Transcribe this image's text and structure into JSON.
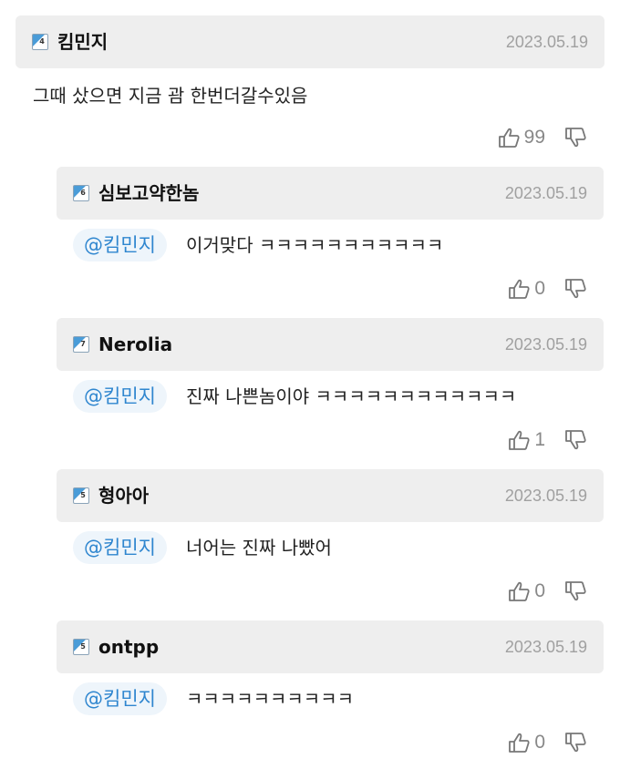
{
  "comments": [
    {
      "level": "4",
      "nickname": "킴민지",
      "date": "2023.05.19",
      "text": "그때 샀으면 지금 괌 한번더갈수있음",
      "likes": "99"
    }
  ],
  "replies": [
    {
      "level": "6",
      "nickname": "심보고약한놈",
      "date": "2023.05.19",
      "mention": "@킴민지",
      "text": "이거맞다 ㅋㅋㅋㅋㅋㅋㅋㅋㅋㅋㅋ",
      "likes": "0"
    },
    {
      "level": "7",
      "nickname": "Nerolia",
      "date": "2023.05.19",
      "mention": "@킴민지",
      "text": "진짜 나쁜놈이야 ㅋㅋㅋㅋㅋㅋㅋㅋㅋㅋㅋㅋ",
      "likes": "1"
    },
    {
      "level": "5",
      "nickname": "형아아",
      "date": "2023.05.19",
      "mention": "@킴민지",
      "text": "너어는 진짜 나빴어",
      "likes": "0"
    },
    {
      "level": "5",
      "nickname": "ontpp",
      "date": "2023.05.19",
      "mention": "@킴민지",
      "text": "ㅋㅋㅋㅋㅋㅋㅋㅋㅋㅋ",
      "likes": "0"
    }
  ],
  "icons": {
    "like": "thumbs-up-icon",
    "dislike": "thumbs-down-icon",
    "level": "level-badge-icon"
  }
}
